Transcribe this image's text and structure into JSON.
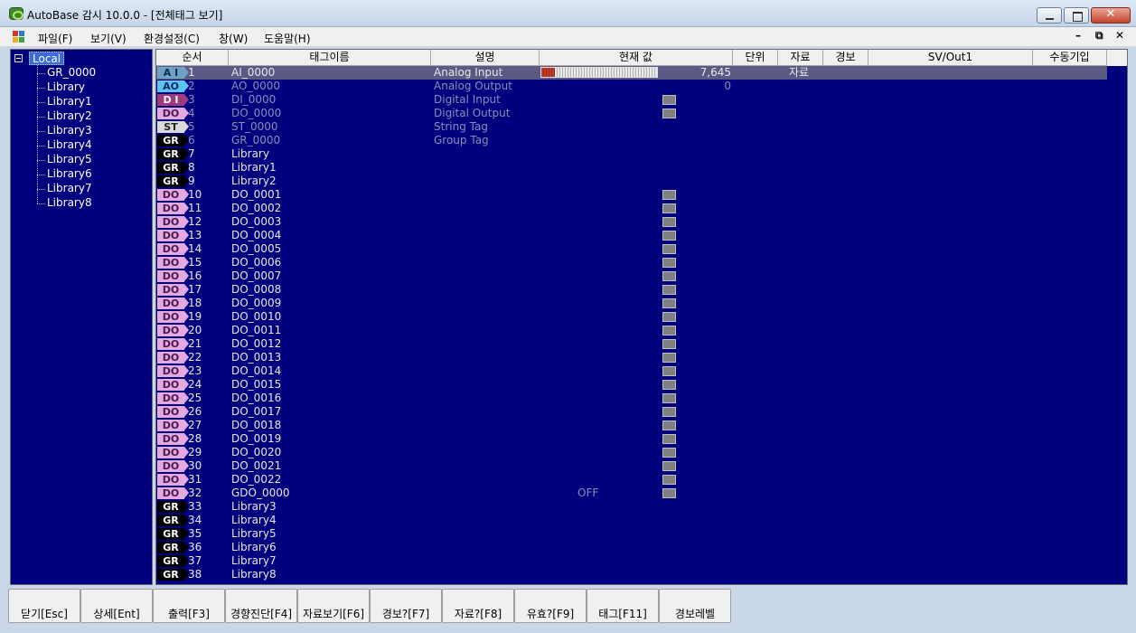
{
  "window": {
    "title": "AutoBase 감시 10.0.0 - [전체태그 보기]"
  },
  "menu": {
    "items": [
      "파일(F)",
      "보기(V)",
      "환경설정(C)",
      "창(W)",
      "도움말(H)"
    ],
    "mdi_restore": "🗗",
    "mdi_close": "✕"
  },
  "tree": {
    "root": "Local",
    "children": [
      "GR_0000",
      "Library",
      "Library1",
      "Library2",
      "Library3",
      "Library4",
      "Library5",
      "Library6",
      "Library7",
      "Library8"
    ]
  },
  "columns": [
    "순서",
    "태그이름",
    "설명",
    "현재 값",
    "단위",
    "자료",
    "경보",
    "SV/Out1",
    "수동기입"
  ],
  "rows": [
    {
      "type": "AI",
      "num": "1",
      "name": "AI_0000",
      "desc": "Analog Input",
      "value": "7,645",
      "data": "자료",
      "bar_fraction": 0.12,
      "selected": true
    },
    {
      "type": "AO",
      "num": "2",
      "name": "AO_0000",
      "desc": "Analog Output",
      "value": "0",
      "dim": true
    },
    {
      "type": "DI",
      "num": "3",
      "name": "DI_0000",
      "desc": "Digital Input",
      "indicator": true,
      "dim": true
    },
    {
      "type": "DO",
      "num": "4",
      "name": "DO_0000",
      "desc": "Digital Output",
      "indicator": true,
      "dim": true
    },
    {
      "type": "ST",
      "num": "5",
      "name": "ST_0000",
      "desc": "String Tag",
      "dim": true
    },
    {
      "type": "GR",
      "num": "6",
      "name": "GR_0000",
      "desc": "Group Tag",
      "dim": true
    },
    {
      "type": "GR",
      "num": "7",
      "name": "Library"
    },
    {
      "type": "GR",
      "num": "8",
      "name": "Library1"
    },
    {
      "type": "GR",
      "num": "9",
      "name": "Library2"
    },
    {
      "type": "DO",
      "num": "10",
      "name": "DO_0001",
      "indicator": true
    },
    {
      "type": "DO",
      "num": "11",
      "name": "DO_0002",
      "indicator": true
    },
    {
      "type": "DO",
      "num": "12",
      "name": "DO_0003",
      "indicator": true
    },
    {
      "type": "DO",
      "num": "13",
      "name": "DO_0004",
      "indicator": true
    },
    {
      "type": "DO",
      "num": "14",
      "name": "DO_0005",
      "indicator": true
    },
    {
      "type": "DO",
      "num": "15",
      "name": "DO_0006",
      "indicator": true
    },
    {
      "type": "DO",
      "num": "16",
      "name": "DO_0007",
      "indicator": true
    },
    {
      "type": "DO",
      "num": "17",
      "name": "DO_0008",
      "indicator": true
    },
    {
      "type": "DO",
      "num": "18",
      "name": "DO_0009",
      "indicator": true
    },
    {
      "type": "DO",
      "num": "19",
      "name": "DO_0010",
      "indicator": true
    },
    {
      "type": "DO",
      "num": "20",
      "name": "DO_0011",
      "indicator": true
    },
    {
      "type": "DO",
      "num": "21",
      "name": "DO_0012",
      "indicator": true
    },
    {
      "type": "DO",
      "num": "22",
      "name": "DO_0013",
      "indicator": true
    },
    {
      "type": "DO",
      "num": "23",
      "name": "DO_0014",
      "indicator": true
    },
    {
      "type": "DO",
      "num": "24",
      "name": "DO_0015",
      "indicator": true
    },
    {
      "type": "DO",
      "num": "25",
      "name": "DO_0016",
      "indicator": true
    },
    {
      "type": "DO",
      "num": "26",
      "name": "DO_0017",
      "indicator": true
    },
    {
      "type": "DO",
      "num": "27",
      "name": "DO_0018",
      "indicator": true
    },
    {
      "type": "DO",
      "num": "28",
      "name": "DO_0019",
      "indicator": true
    },
    {
      "type": "DO",
      "num": "29",
      "name": "DO_0020",
      "indicator": true
    },
    {
      "type": "DO",
      "num": "30",
      "name": "DO_0021",
      "indicator": true
    },
    {
      "type": "DO",
      "num": "31",
      "name": "DO_0022",
      "indicator": true
    },
    {
      "type": "DO",
      "num": "32",
      "name": "GDO_0000",
      "value_text": "OFF",
      "indicator": true
    },
    {
      "type": "GR",
      "num": "33",
      "name": "Library3"
    },
    {
      "type": "GR",
      "num": "34",
      "name": "Library4"
    },
    {
      "type": "GR",
      "num": "35",
      "name": "Library5"
    },
    {
      "type": "GR",
      "num": "36",
      "name": "Library6"
    },
    {
      "type": "GR",
      "num": "37",
      "name": "Library7"
    },
    {
      "type": "GR",
      "num": "38",
      "name": "Library8"
    }
  ],
  "type_labels": {
    "AI": "A I",
    "AO": "AO",
    "DI": "D I",
    "DO": "DO",
    "ST": "ST",
    "GR": "GR"
  },
  "toolbar": [
    "닫기[Esc]",
    "상세[Ent]",
    "출력[F3]",
    "경향진단[F4]",
    "자료보기[F6]",
    "경보?[F7]",
    "자료?[F8]",
    "유효?[F9]",
    "태그[F11]",
    "경보레벨"
  ],
  "colors": {
    "grid_bg": "#00007e",
    "accent_selected": "#5a5a84",
    "bar_fill": "#c63a2a"
  }
}
